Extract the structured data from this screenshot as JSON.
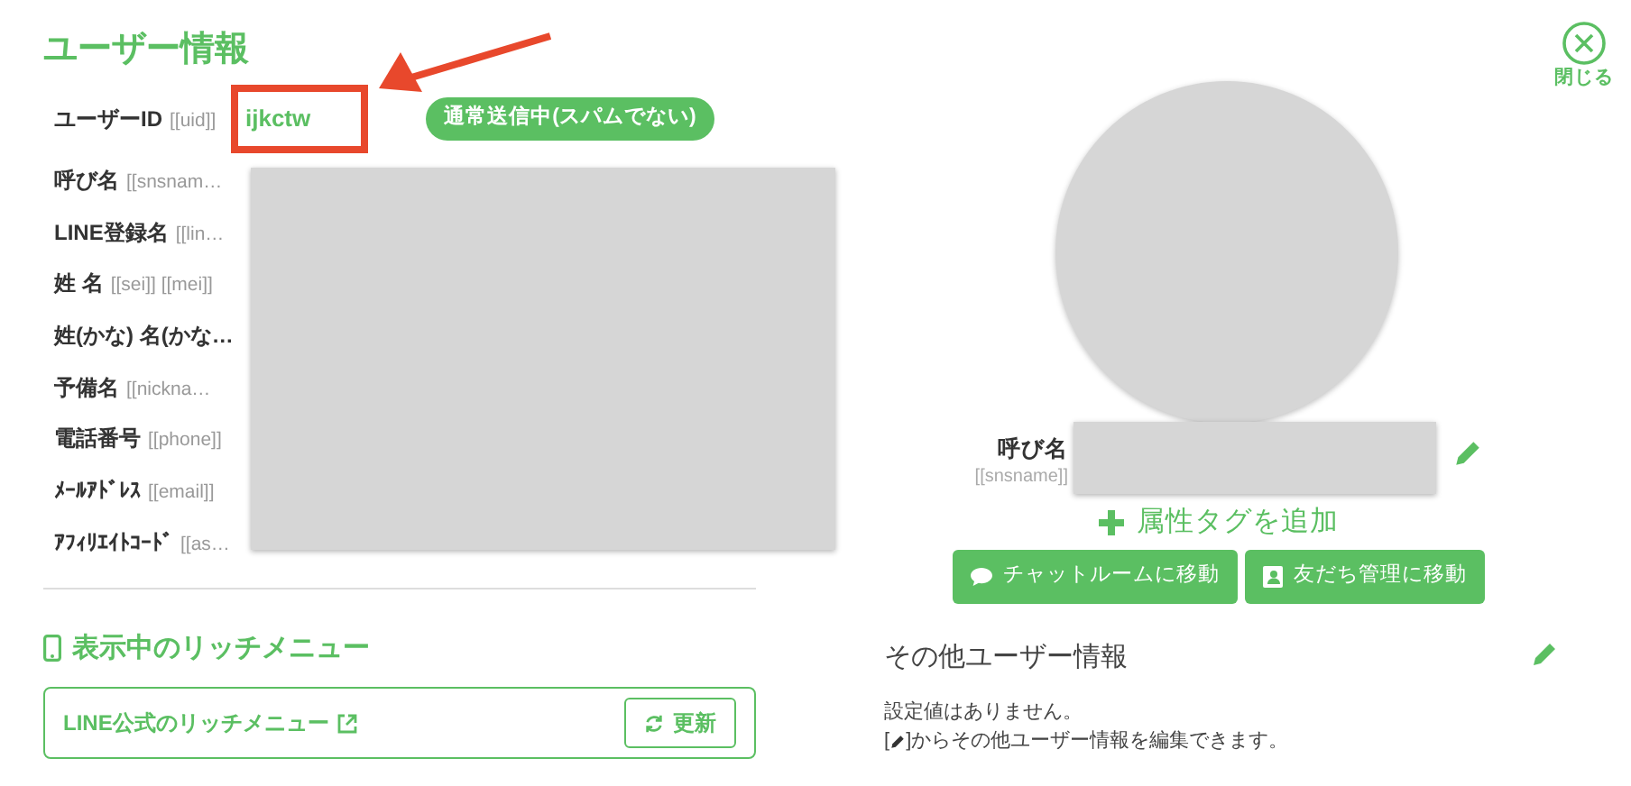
{
  "title": "ユーザー情報",
  "close": {
    "label": "閉じる"
  },
  "fields": [
    {
      "label": "ユーザーID",
      "tag": "[[uid]]",
      "value": "ijkctw",
      "badge": "通常送信中(スパムでない)"
    },
    {
      "label": "呼び名",
      "tag": "[[snsnam…"
    },
    {
      "label": "LINE登録名",
      "tag": "[[lin…"
    },
    {
      "label": "姓 名",
      "tag": "[[sei]] [[mei]]"
    },
    {
      "label": "姓(かな) 名(かな…"
    },
    {
      "label": "予備名",
      "tag": "[[nickna…"
    },
    {
      "label": "電話番号",
      "tag": "[[phone]]"
    },
    {
      "label": "ﾒｰﾙｱﾄﾞﾚｽ",
      "tag": "[[email]]"
    },
    {
      "label": "ｱﾌｨﾘｴｲﾄｺｰﾄﾞ",
      "tag": "[[as…"
    }
  ],
  "rich_menu": {
    "heading": "表示中のリッチメニュー",
    "link": "LINE公式のリッチメニュー",
    "refresh": "更新"
  },
  "profile": {
    "label": "呼び名",
    "tag": "[[snsname]]",
    "add_tag": "属性タグを追加",
    "buttons": [
      {
        "kind": "chat",
        "label": "チャットルームに移動"
      },
      {
        "kind": "contact",
        "label": "友だち管理に移動"
      }
    ]
  },
  "other_info": {
    "heading": "その他ユーザー情報",
    "line1": "設定値はありません。",
    "note_prefix": "[",
    "note_suffix": "]からその他ユーザー情報を編集できます。"
  }
}
